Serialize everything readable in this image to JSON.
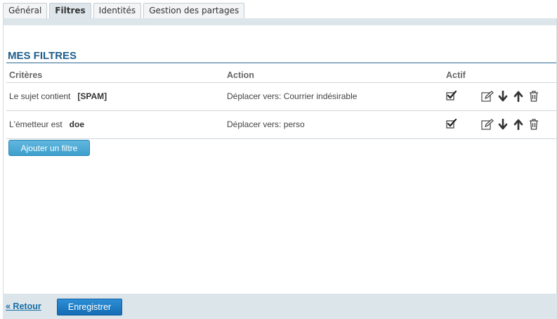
{
  "tabs": [
    {
      "label": "Général",
      "active": false
    },
    {
      "label": "Filtres",
      "active": true
    },
    {
      "label": "Identités",
      "active": false
    },
    {
      "label": "Gestion des partages",
      "active": false
    }
  ],
  "section": {
    "title": "MES FILTRES"
  },
  "table": {
    "headers": {
      "criteria": "Critères",
      "action": "Action",
      "active": "Actif"
    },
    "rows": [
      {
        "criteria_label": "Le sujet contient",
        "criteria_value": "[SPAM]",
        "action": "Déplacer vers: Courrier indésirable",
        "active": true
      },
      {
        "criteria_label": "L'émetteur est",
        "criteria_value": "doe",
        "action": "Déplacer vers: perso",
        "active": true
      }
    ]
  },
  "buttons": {
    "add_filter": "Ajouter un filtre",
    "save": "Enregistrer"
  },
  "footer": {
    "back_link": "« Retour"
  },
  "colors": {
    "accent": "#1f5e8c",
    "add_button": "#4aa9d5",
    "save_button": "#1a78c2",
    "bar": "#dce5ea"
  },
  "icons": [
    "checkmark-icon",
    "edit-icon",
    "arrow-down-icon",
    "arrow-up-icon",
    "trash-icon"
  ]
}
